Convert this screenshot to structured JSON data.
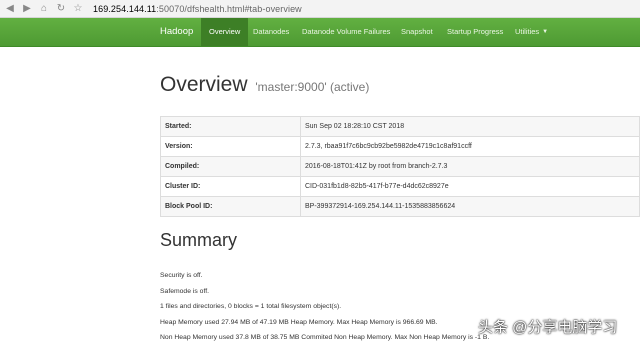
{
  "browser": {
    "back_icon": "back-arrow-icon",
    "forward_icon": "forward-arrow-icon",
    "home_icon": "home-icon",
    "url_host": "169.254.144.11",
    "url_rest": ":50070/dfshealth.html#tab-overview"
  },
  "navbar": {
    "brand": "Hadoop",
    "items": [
      {
        "label": "Overview"
      },
      {
        "label": "Datanodes"
      },
      {
        "label": "Datanode Volume Failures"
      },
      {
        "label": "Snapshot"
      },
      {
        "label": "Startup Progress"
      },
      {
        "label": "Utilities"
      }
    ],
    "accent": "#5aaa3c"
  },
  "overview": {
    "title": "Overview",
    "subtitle": "'master:9000' (active)",
    "rows": [
      {
        "key": "Started:",
        "value": "Sun Sep 02 18:28:10 CST 2018"
      },
      {
        "key": "Version:",
        "value": "2.7.3, rbaa91f7c6bc9cb92be5982de4719c1c8af91ccff"
      },
      {
        "key": "Compiled:",
        "value": "2016-08-18T01:41Z by root from branch-2.7.3"
      },
      {
        "key": "Cluster ID:",
        "value": "CID-031fb1d8-82b5-417f-b77e-d4dc62c8927e"
      },
      {
        "key": "Block Pool ID:",
        "value": "BP-399372914-169.254.144.11-1535883856624"
      }
    ]
  },
  "summary": {
    "title": "Summary",
    "lines": [
      "Security is off.",
      "Safemode is off.",
      "1 files and directories, 0 blocks = 1 total filesystem object(s).",
      "Heap Memory used 27.94 MB of 47.19 MB Heap Memory. Max Heap Memory is 966.69 MB.",
      "Non Heap Memory used 37.8 MB of 38.75 MB Commited Non Heap Memory. Max Non Heap Memory is -1 B."
    ]
  },
  "watermark": "头条 @分享电脑学习"
}
